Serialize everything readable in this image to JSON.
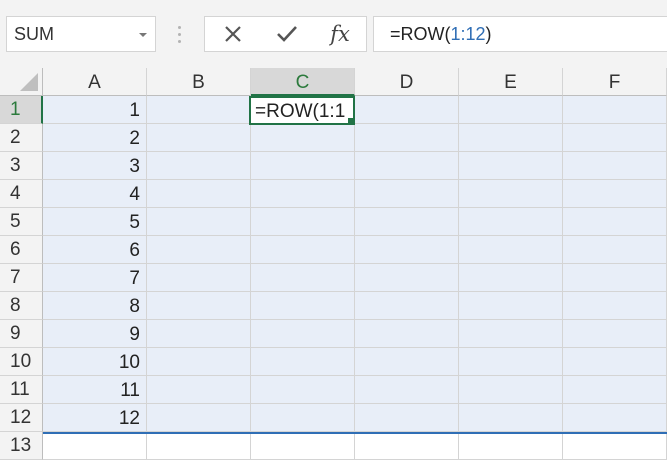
{
  "namebox": {
    "value": "SUM"
  },
  "formula_bar": {
    "cancel_icon": "x-icon",
    "enter_icon": "check-icon",
    "fx_label": "fx",
    "formula_prefix": "=ROW(",
    "formula_ref": "1:12",
    "formula_suffix": ")"
  },
  "columns": [
    "A",
    "B",
    "C",
    "D",
    "E",
    "F"
  ],
  "active_column": "C",
  "rows": [
    "1",
    "2",
    "3",
    "4",
    "5",
    "6",
    "7",
    "8",
    "9",
    "10",
    "11",
    "12",
    "13"
  ],
  "active_row": "1",
  "cell_values_A": [
    "1",
    "2",
    "3",
    "4",
    "5",
    "6",
    "7",
    "8",
    "9",
    "10",
    "11",
    "12"
  ],
  "active_cell": {
    "ref": "C1",
    "text": "=ROW(1:1"
  },
  "colors": {
    "selection": "#e8eef8",
    "active_border": "#217346",
    "ref_blue": "#2f6eb5"
  }
}
